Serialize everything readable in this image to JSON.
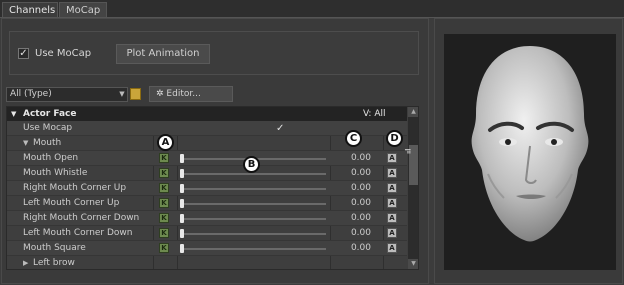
{
  "tabs": [
    {
      "label": "Channels"
    },
    {
      "label": "MoCap"
    }
  ],
  "mocap": {
    "use_mocap_label": "Use MoCap",
    "use_mocap_checked": true,
    "plot_button": "Plot Animation"
  },
  "toolbar": {
    "filter_value": "All (Type)",
    "editor_button": "Editor..."
  },
  "table": {
    "header": {
      "title": "Actor Face",
      "visibility": "V: All"
    },
    "use_mocap_row": {
      "label": "Use Mocap",
      "checked": true
    },
    "group_mouth": {
      "label": "Mouth"
    },
    "rows": [
      {
        "label": "Mouth Open",
        "key": "K",
        "value": "0.00",
        "anim": "A",
        "fraction": 0.0
      },
      {
        "label": "Mouth Whistle",
        "key": "K",
        "value": "0.00",
        "anim": "A",
        "fraction": 0.0
      },
      {
        "label": "Right Mouth Corner Up",
        "key": "K",
        "value": "0.00",
        "anim": "A",
        "fraction": 0.0
      },
      {
        "label": "Left Mouth Corner Up",
        "key": "K",
        "value": "0.00",
        "anim": "A",
        "fraction": 0.0
      },
      {
        "label": "Right Mouth Corner Down",
        "key": "K",
        "value": "0.00",
        "anim": "A",
        "fraction": 0.0
      },
      {
        "label": "Left Mouth Corner Down",
        "key": "K",
        "value": "0.00",
        "anim": "A",
        "fraction": 0.0
      },
      {
        "label": "Mouth Square",
        "key": "K",
        "value": "0.00",
        "anim": "A",
        "fraction": 0.0
      }
    ],
    "group_left_brow": {
      "label": "Left brow"
    }
  },
  "callouts": [
    "A",
    "B",
    "C",
    "D"
  ],
  "colors": {
    "key_green": "#6d8a4f",
    "slider_thumb": "#e8e8e8",
    "lock_yellow": "#caa53a"
  }
}
